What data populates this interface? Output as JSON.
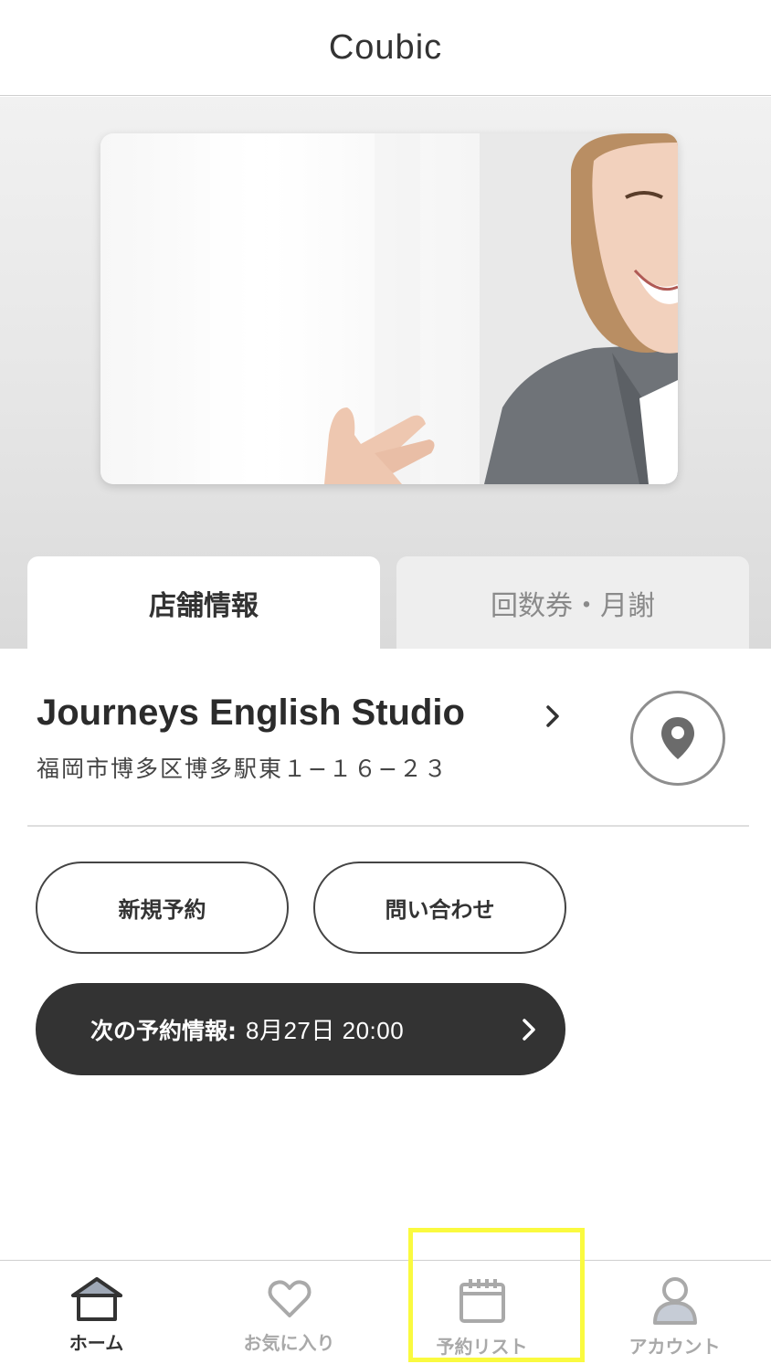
{
  "app": {
    "logo_text": "Coubic"
  },
  "hero": {
    "image_alt": "smiling woman"
  },
  "tabs": [
    {
      "label": "店舗情報",
      "active": true
    },
    {
      "label": "回数券・月謝",
      "active": false
    }
  ],
  "store": {
    "name": "Journeys English Studio",
    "address": "福岡市博多区博多駅東１−１６−２３",
    "map_icon": "location-pin-icon"
  },
  "actions": {
    "new_booking_label": "新規予約",
    "contact_label": "問い合わせ"
  },
  "next_booking": {
    "label": "次の予約情報:",
    "value": "8月27日 20:00"
  },
  "bottom_nav": [
    {
      "label": "ホーム",
      "icon": "home-icon",
      "active": true
    },
    {
      "label": "お気に入り",
      "icon": "heart-icon",
      "active": false
    },
    {
      "label": "予約リスト",
      "icon": "calendar-icon",
      "active": false
    },
    {
      "label": "アカウント",
      "icon": "person-icon",
      "active": false
    }
  ],
  "colors": {
    "text_primary": "#333333",
    "tab_inactive_bg": "#eeeeee",
    "next_bar_bg": "#333333",
    "nav_inactive": "#a9a9a9",
    "highlight": "#fafa3f"
  }
}
